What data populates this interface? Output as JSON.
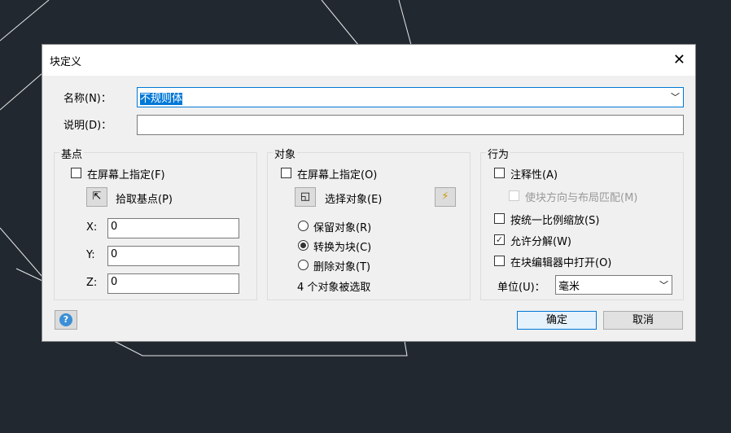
{
  "dialog": {
    "title": "块定义",
    "close_icon": "close-icon"
  },
  "name": {
    "label": "名称(N)：",
    "value": "不规则体"
  },
  "description": {
    "label": "说明(D)：",
    "value": ""
  },
  "base_point": {
    "title": "基点",
    "specify_on_screen": "在屏幕上指定(F)",
    "pick_button": "拾取基点(P)",
    "x_label": "X:",
    "x": "0",
    "y_label": "Y:",
    "y": "0",
    "z_label": "Z:",
    "z": "0"
  },
  "objects": {
    "title": "对象",
    "specify_on_screen": "在屏幕上指定(O)",
    "select_button": "选择对象(E)",
    "retain": "保留对象(R)",
    "convert": "转换为块(C)",
    "delete": "删除对象(T)",
    "selected_count": "4 个对象被选取"
  },
  "behavior": {
    "title": "行为",
    "annotative": "注释性(A)",
    "match_orientation": "使块方向与布局匹配(M)",
    "scale_uniformly": "按统一比例缩放(S)",
    "allow_explode": "允许分解(W)",
    "open_in_editor": "在块编辑器中打开(O)",
    "unit_label": "单位(U)：",
    "unit_value": "毫米"
  },
  "buttons": {
    "ok": "确定",
    "cancel": "取消",
    "help": "?"
  }
}
